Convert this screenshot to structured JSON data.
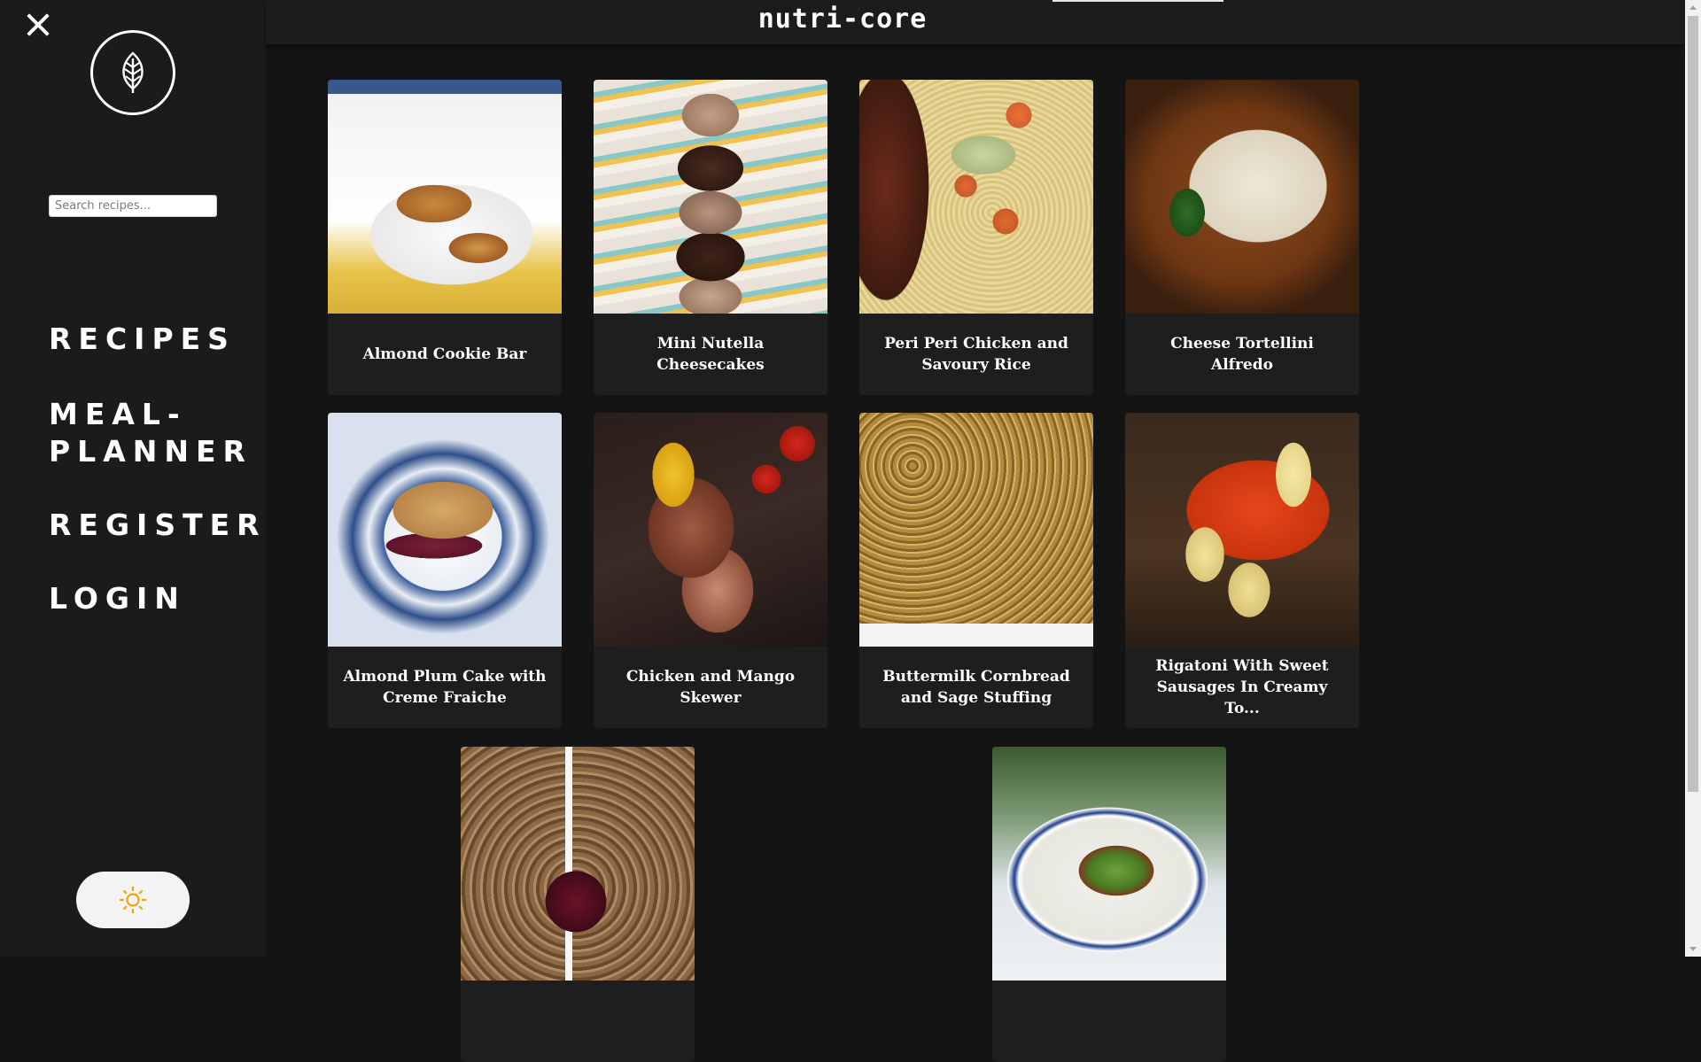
{
  "header": {
    "site_title": "nutri-core"
  },
  "sidebar": {
    "close_icon": "close-icon",
    "logo_icon": "leaf-icon",
    "search": {
      "placeholder": "Search recipes...",
      "value": ""
    },
    "nav": [
      {
        "label": "RECIPES"
      },
      {
        "label": "MEAL-PLANNER"
      },
      {
        "label": "REGISTER"
      },
      {
        "label": "LOGIN"
      }
    ],
    "theme_toggle_icon": "sun-icon"
  },
  "recipes": [
    {
      "title": "Almond Cookie Bar"
    },
    {
      "title": "Mini Nutella Cheesecakes"
    },
    {
      "title": "Peri Peri Chicken and Savoury Rice"
    },
    {
      "title": "Cheese Tortellini Alfredo"
    },
    {
      "title": "Almond Plum Cake with Creme Fraiche"
    },
    {
      "title": "Chicken and Mango Skewer"
    },
    {
      "title": "Buttermilk Cornbread and Sage Stuffing"
    },
    {
      "title": "Rigatoni With Sweet Sausages In Creamy To..."
    },
    {
      "title": ""
    },
    {
      "title": ""
    }
  ],
  "colors": {
    "sidebar_bg": "#1b1b1b",
    "page_bg": "#141414",
    "card_bg": "#1e1e1e",
    "text": "#ffffff",
    "sun_icon": "#f0a30a"
  }
}
